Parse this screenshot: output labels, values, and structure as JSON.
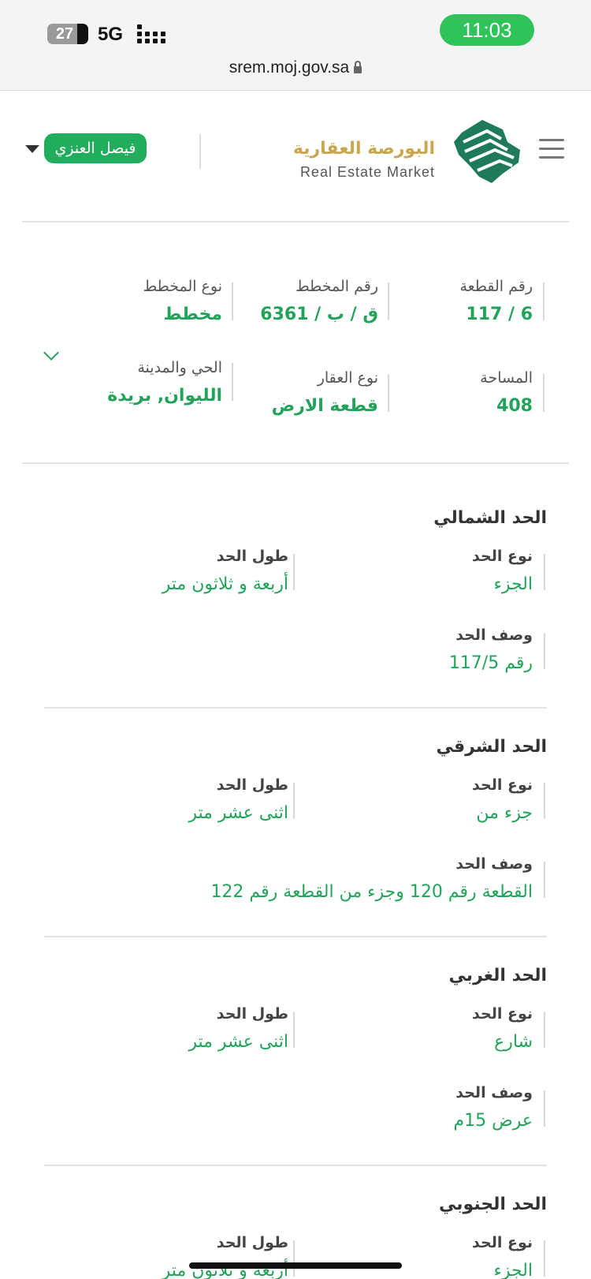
{
  "status_bar": {
    "battery": "27",
    "network": "5G",
    "time": "11:03"
  },
  "browser": {
    "url": "srem.moj.gov.sa"
  },
  "header": {
    "logo_ar": "البورصة العقارية",
    "logo_en": "Real Estate Market",
    "user_name": "فيصل العنزي"
  },
  "property": {
    "plot_number_label": "رقم القطعة",
    "plot_number": "6 / 117",
    "plan_number_label": "رقم المخطط",
    "plan_number": "ق / ب / 6361",
    "plan_type_label": "نوع المخطط",
    "plan_type": "مخطط",
    "area_label": "المساحة",
    "area": "408",
    "property_type_label": "نوع العقار",
    "property_type": "قطعة الارض",
    "district_city_label": "الحي والمدينة",
    "district_city": "الليوان, بريدة"
  },
  "borders": [
    {
      "title": "الحد الشمالي",
      "type_label": "نوع الحد",
      "type": "الجزء",
      "length_label": "طول الحد",
      "length": "أربعة و ثلاثون متر",
      "desc_label": "وصف الحد",
      "desc": "رقم 117/5"
    },
    {
      "title": "الحد الشرقي",
      "type_label": "نوع الحد",
      "type": "جزء من",
      "length_label": "طول الحد",
      "length": "اثنى عشر متر",
      "desc_label": "وصف الحد",
      "desc": "القطعة رقم 120 وجزء من القطعة رقم 122"
    },
    {
      "title": "الحد الغربي",
      "type_label": "نوع الحد",
      "type": "شارع",
      "length_label": "طول الحد",
      "length": "اثنى عشر متر",
      "desc_label": "وصف الحد",
      "desc": "عرض 15م"
    },
    {
      "title": "الحد الجنوبي",
      "type_label": "نوع الحد",
      "type": "الجزء",
      "length_label": "طول الحد",
      "length": "أربعة و ثلاثون متر"
    }
  ],
  "colors": {
    "accent": "#21a35a",
    "clock": "#2fc35a",
    "logo_gold": "#c8a74f"
  }
}
